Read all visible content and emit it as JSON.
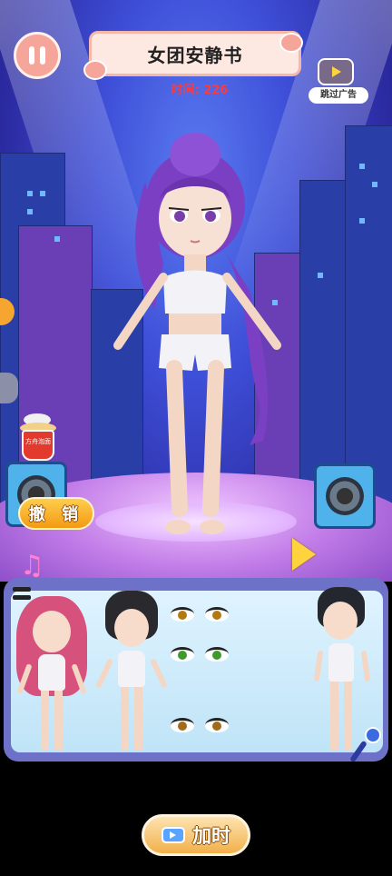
{
  "header": {
    "title": "女团安静书",
    "timer": "时间: 226",
    "skip_ad_label": "跳过广告"
  },
  "scene": {
    "undo_label": "撤 销",
    "noodle_label": "方舟泡面"
  },
  "wardrobe": {
    "items": [
      {
        "kind": "hairstyle",
        "desc": "pink twin-tail hair"
      },
      {
        "kind": "hairstyle",
        "desc": "black bun hair"
      },
      {
        "kind": "eyes",
        "desc": "amber eyes"
      },
      {
        "kind": "eyes",
        "desc": "green eyes"
      },
      {
        "kind": "eyes",
        "desc": "brown cute eyes"
      },
      {
        "kind": "hairstyle",
        "desc": "black short hair"
      }
    ]
  },
  "footer": {
    "add_time_label": "加时"
  },
  "colors": {
    "accent": "#f5a59a",
    "timer": "#ff3a3a",
    "button": "#f39a13",
    "panel": "#6d72c8",
    "hair": "#7b3fc4"
  }
}
